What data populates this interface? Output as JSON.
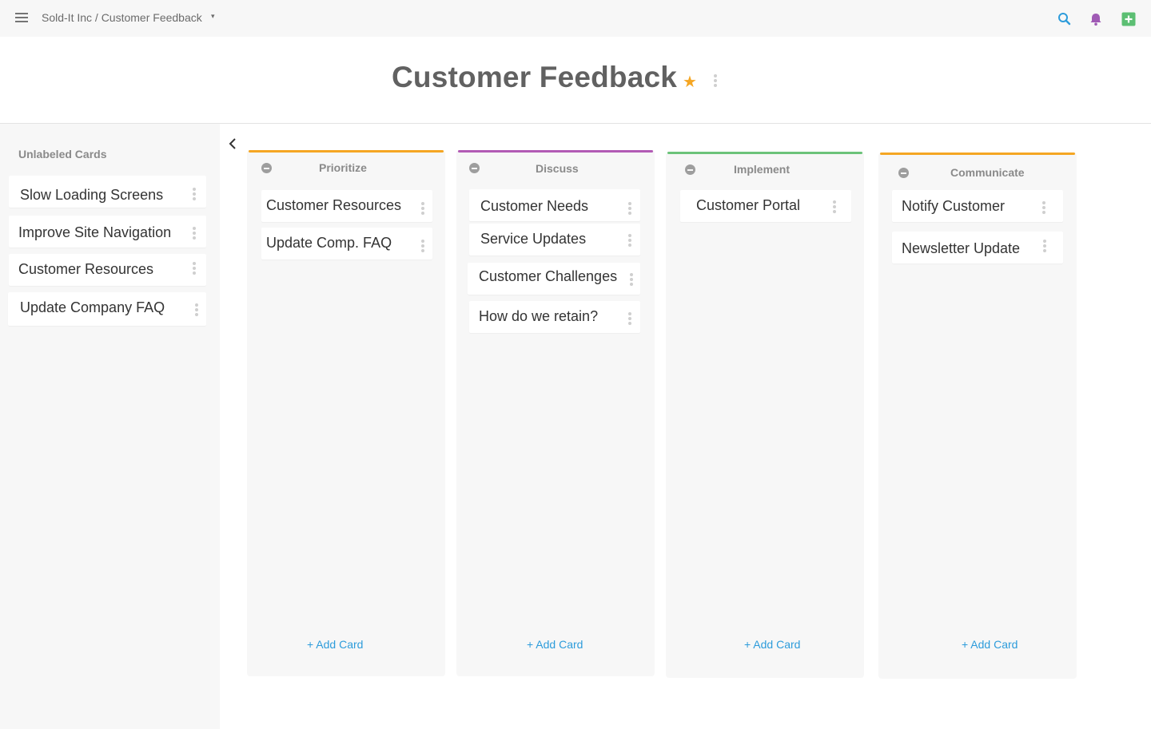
{
  "topbar": {
    "breadcrumb": "Sold-It Inc / Customer Feedback",
    "caret": "▾",
    "icons": {
      "search": "search-icon",
      "bell": "bell-icon",
      "add": "add-icon"
    },
    "colors": {
      "search": "#2d9cdb",
      "bell": "#a05bb5",
      "add": "#5cbf73"
    }
  },
  "header": {
    "title": "Customer Feedback",
    "star": "★"
  },
  "sidebar": {
    "title": "Unlabeled Cards",
    "cards": [
      {
        "label": "Slow Loading Screens"
      },
      {
        "label": "Improve Site Navigation"
      },
      {
        "label": "Customer Resources"
      },
      {
        "label": "Update Company FAQ"
      }
    ]
  },
  "columns": [
    {
      "title": "Prioritize",
      "color": "#f5a623",
      "cards": [
        {
          "label": "Customer Resources"
        },
        {
          "label": "Update Comp. FAQ"
        }
      ],
      "add_label": "+ Add Card"
    },
    {
      "title": "Discuss",
      "color": "#b25bb5",
      "cards": [
        {
          "label": "Customer Needs"
        },
        {
          "label": "Service Updates"
        },
        {
          "label": "Customer Challenges"
        },
        {
          "label": "How do we retain?"
        }
      ],
      "add_label": "+ Add Card"
    },
    {
      "title": "Implement",
      "color": "#6cc37a",
      "cards": [
        {
          "label": "Customer Portal"
        }
      ],
      "add_label": "+ Add Card"
    },
    {
      "title": "Communicate",
      "color": "#f5a623",
      "cards": [
        {
          "label": "Notify Customer"
        },
        {
          "label": "Newsletter Update"
        }
      ],
      "add_label": "+ Add Card"
    }
  ]
}
